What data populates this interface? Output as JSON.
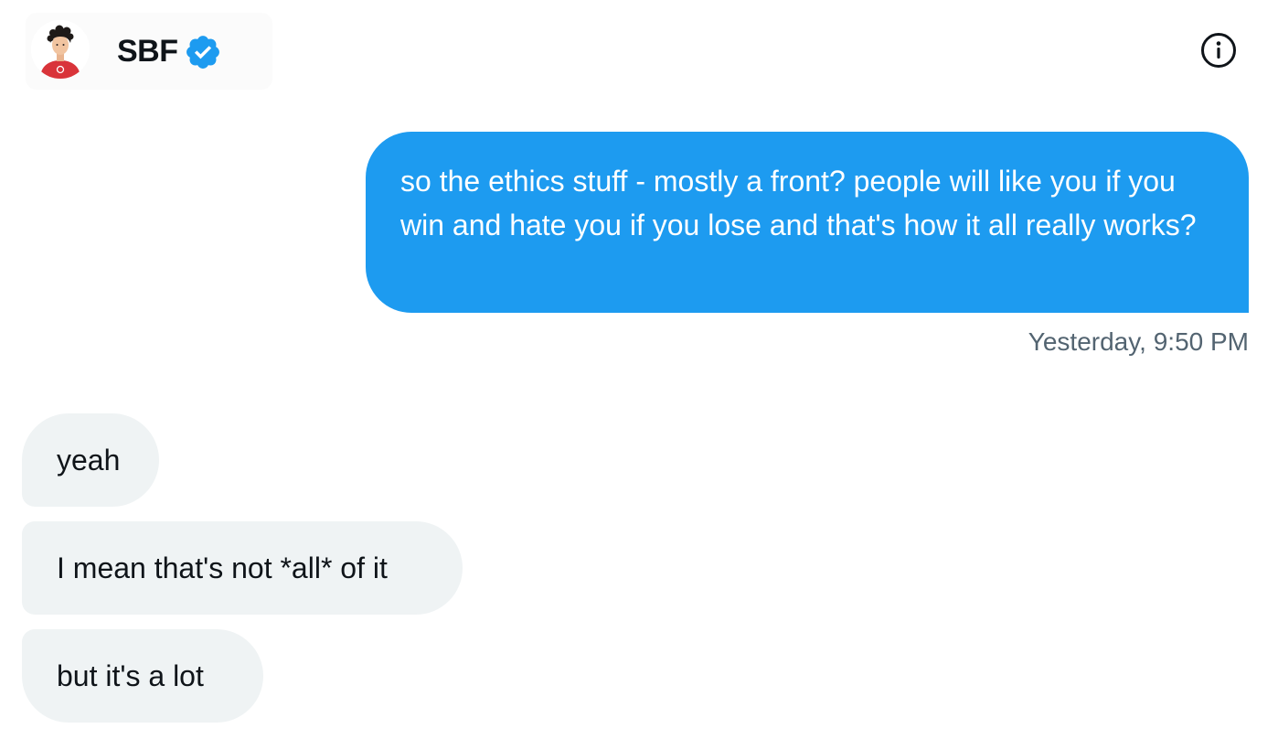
{
  "header": {
    "contact_name": "SBF",
    "verified": true,
    "icons": {
      "avatar": "avatar-illustration",
      "verified": "verified-badge-icon",
      "info": "info-icon"
    },
    "accent_color": "#1d9bf0"
  },
  "conversation": {
    "sent": [
      {
        "text": "so the ethics stuff - mostly a front? people will like you if you win and hate you if you lose and that's how it all really works?",
        "timestamp": "Yesterday, 9:50 PM"
      }
    ],
    "received": [
      {
        "text": "yeah"
      },
      {
        "text": "I mean that's not *all* of it"
      },
      {
        "text": "but it's a lot"
      }
    ]
  },
  "colors": {
    "sent_bubble": "#1d9bf0",
    "received_bubble": "#eff3f4",
    "text_primary": "#0f1419",
    "text_secondary": "#536471"
  }
}
